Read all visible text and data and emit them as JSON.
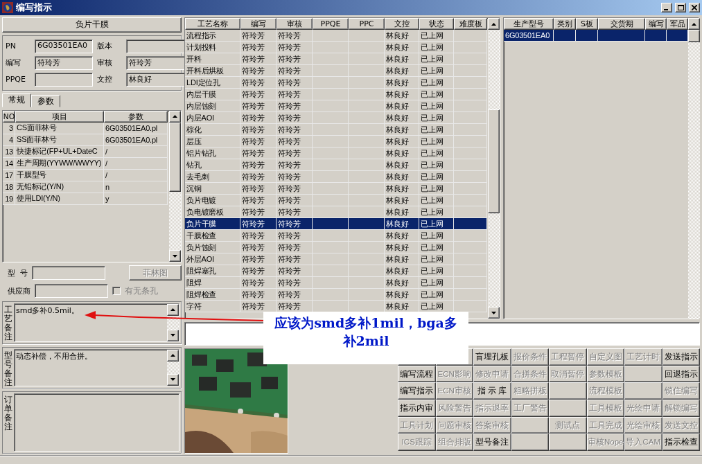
{
  "window": {
    "title": "编写指示"
  },
  "left": {
    "header_button": "负片干膜",
    "fields": [
      {
        "label": "PN",
        "value": "6G03501EA0"
      },
      {
        "label": "版本"
      },
      {
        "label": "编写",
        "value": "符玲芳"
      },
      {
        "label": "审核",
        "value": "符玲芳"
      },
      {
        "label": "PPQE"
      },
      {
        "label": "文控",
        "value": "林良好"
      }
    ],
    "tabs": [
      {
        "label": "常规",
        "selected": true
      },
      {
        "label": "参数",
        "selected": false
      }
    ],
    "grid": {
      "columns": [
        "NO",
        "项目",
        "参数"
      ],
      "rows": [
        {
          "no": "3",
          "item": "CS面菲林号",
          "param": "6G03501EA0.pl"
        },
        {
          "no": "4",
          "item": "SS面菲林号",
          "param": "6G03501EA0.pl"
        },
        {
          "no": "13",
          "item": "快捷标记(FP+UL+DateC",
          "param": "/"
        },
        {
          "no": "14",
          "item": "生产周期(YYWW/WWYY)",
          "param": "/"
        },
        {
          "no": "17",
          "item": "干膜型号",
          "param": "/"
        },
        {
          "no": "18",
          "item": "无铅标记(Y/N)",
          "param": "n"
        },
        {
          "no": "19",
          "item": "使用LDI(Y/N)",
          "param": "y"
        }
      ]
    },
    "model": {
      "label": "型  号",
      "button": "菲林图",
      "button_disabled": true
    },
    "supplier": {
      "label": "供应商",
      "checkbox": "有无条孔",
      "checked": false,
      "checkbox_disabled": true
    },
    "memos": [
      {
        "label": "工艺备注",
        "text": "smd多补0.5mil。",
        "scroll": true
      },
      {
        "label": "型号备注",
        "text": "动态补偿，不用合拼。",
        "scroll": true
      },
      {
        "label": "订单备注",
        "scroll": false
      }
    ]
  },
  "process_table": {
    "columns": [
      "工艺名称",
      "编写",
      "审核",
      "PPQE",
      "PPC",
      "文控",
      "状态",
      "难度板"
    ],
    "rows": [
      {
        "cells": [
          "流程指示",
          "符玲芳",
          "符玲芳",
          "",
          "",
          "林良好",
          "已上网",
          ""
        ],
        "selected": false
      },
      {
        "cells": [
          "计划投料",
          "符玲芳",
          "符玲芳",
          "",
          "",
          "林良好",
          "已上网",
          ""
        ],
        "selected": false
      },
      {
        "cells": [
          "开料",
          "符玲芳",
          "符玲芳",
          "",
          "",
          "林良好",
          "已上网",
          ""
        ],
        "selected": false
      },
      {
        "cells": [
          "开料后烘板",
          "符玲芳",
          "符玲芳",
          "",
          "",
          "林良好",
          "已上网",
          ""
        ],
        "selected": false
      },
      {
        "cells": [
          "LDI定位孔",
          "符玲芳",
          "符玲芳",
          "",
          "",
          "林良好",
          "已上网",
          ""
        ],
        "selected": false
      },
      {
        "cells": [
          "内层干膜",
          "符玲芳",
          "符玲芳",
          "",
          "",
          "林良好",
          "已上网",
          ""
        ],
        "selected": false
      },
      {
        "cells": [
          "内层蚀刻",
          "符玲芳",
          "符玲芳",
          "",
          "",
          "林良好",
          "已上网",
          ""
        ],
        "selected": false
      },
      {
        "cells": [
          "内层AOI",
          "符玲芳",
          "符玲芳",
          "",
          "",
          "林良好",
          "已上网",
          ""
        ],
        "selected": false
      },
      {
        "cells": [
          "棕化",
          "符玲芳",
          "符玲芳",
          "",
          "",
          "林良好",
          "已上网",
          ""
        ],
        "selected": false
      },
      {
        "cells": [
          "层压",
          "符玲芳",
          "符玲芳",
          "",
          "",
          "林良好",
          "已上网",
          ""
        ],
        "selected": false
      },
      {
        "cells": [
          "铝片钻孔",
          "符玲芳",
          "符玲芳",
          "",
          "",
          "林良好",
          "已上网",
          ""
        ],
        "selected": false
      },
      {
        "cells": [
          "钻孔",
          "符玲芳",
          "符玲芳",
          "",
          "",
          "林良好",
          "已上网",
          ""
        ],
        "selected": false
      },
      {
        "cells": [
          "去毛刺",
          "符玲芳",
          "符玲芳",
          "",
          "",
          "林良好",
          "已上网",
          ""
        ],
        "selected": false
      },
      {
        "cells": [
          "沉铜",
          "符玲芳",
          "符玲芳",
          "",
          "",
          "林良好",
          "已上网",
          ""
        ],
        "selected": false
      },
      {
        "cells": [
          "负片电镀",
          "符玲芳",
          "符玲芳",
          "",
          "",
          "林良好",
          "已上网",
          ""
        ],
        "selected": false
      },
      {
        "cells": [
          "负电镀磨板",
          "符玲芳",
          "符玲芳",
          "",
          "",
          "林良好",
          "已上网",
          ""
        ],
        "selected": false
      },
      {
        "cells": [
          "负片干膜",
          "符玲芳",
          "符玲芳",
          "",
          "",
          "林良好",
          "已上网",
          ""
        ],
        "selected": true
      },
      {
        "cells": [
          "干膜检查",
          "符玲芳",
          "符玲芳",
          "",
          "",
          "林良好",
          "已上网",
          ""
        ],
        "selected": false
      },
      {
        "cells": [
          "负片蚀刻",
          "符玲芳",
          "符玲芳",
          "",
          "",
          "林良好",
          "已上网",
          ""
        ],
        "selected": false
      },
      {
        "cells": [
          "外层AOI",
          "符玲芳",
          "符玲芳",
          "",
          "",
          "林良好",
          "已上网",
          ""
        ],
        "selected": false
      },
      {
        "cells": [
          "阻焊塞孔",
          "符玲芳",
          "符玲芳",
          "",
          "",
          "林良好",
          "已上网",
          ""
        ],
        "selected": false
      },
      {
        "cells": [
          "阻焊",
          "符玲芳",
          "符玲芳",
          "",
          "",
          "林良好",
          "已上网",
          ""
        ],
        "selected": false
      },
      {
        "cells": [
          "阻焊检查",
          "符玲芳",
          "符玲芳",
          "",
          "",
          "林良好",
          "已上网",
          ""
        ],
        "selected": false
      },
      {
        "cells": [
          "字符",
          "符玲芳",
          "符玲芳",
          "",
          "",
          "林良好",
          "已上网",
          ""
        ],
        "selected": false
      }
    ]
  },
  "model_table": {
    "columns": [
      "生产型号",
      "类别",
      "S板",
      "交货期",
      "编写",
      "军品"
    ],
    "rows": [
      {
        "cells": [
          "6G03501EA0",
          "",
          "",
          "",
          "",
          ""
        ],
        "selected": true
      }
    ]
  },
  "buttons": [
    [
      {
        "kind": "blank"
      },
      {
        "kind": "blank"
      },
      {
        "kind": "command",
        "label": "盲埋孔板",
        "disabled": false
      },
      {
        "kind": "command",
        "label": "报价条件",
        "disabled": true
      },
      {
        "kind": "command",
        "label": "工程暂停",
        "disabled": true
      },
      {
        "kind": "command",
        "label": "自定义图",
        "disabled": true
      },
      {
        "kind": "command",
        "label": "工艺计时",
        "disabled": true
      },
      {
        "kind": "command",
        "label": "发送指示",
        "disabled": false
      }
    ],
    [
      {
        "kind": "command",
        "label": "编写流程",
        "disabled": false
      },
      {
        "kind": "command",
        "label": "ECN影响",
        "disabled": true
      },
      {
        "kind": "command",
        "label": "修改申请",
        "disabled": true
      },
      {
        "kind": "command",
        "label": "合拼条件",
        "disabled": true
      },
      {
        "kind": "command",
        "label": "取消暂停",
        "disabled": true
      },
      {
        "kind": "command",
        "label": "参数模板",
        "disabled": true
      },
      {
        "kind": "blank"
      },
      {
        "kind": "command",
        "label": "回退指示",
        "disabled": false
      }
    ],
    [
      {
        "kind": "command",
        "label": "编写指示",
        "disabled": false
      },
      {
        "kind": "command",
        "label": "ECN审核",
        "disabled": true
      },
      {
        "kind": "command",
        "label": "指 示 库",
        "disabled": false
      },
      {
        "kind": "command",
        "label": "粗略拼板",
        "disabled": true
      },
      {
        "kind": "blank"
      },
      {
        "kind": "command",
        "label": "流程模板",
        "disabled": true
      },
      {
        "kind": "blank"
      },
      {
        "kind": "command",
        "label": "锁住编写",
        "disabled": true
      }
    ],
    [
      {
        "kind": "command",
        "label": "指示内审",
        "disabled": false
      },
      {
        "kind": "command",
        "label": "风险警告",
        "disabled": true
      },
      {
        "kind": "command",
        "label": "指示退率",
        "disabled": true
      },
      {
        "kind": "command",
        "label": "工厂警告",
        "disabled": true
      },
      {
        "kind": "blank"
      },
      {
        "kind": "command",
        "label": "工具模板",
        "disabled": true
      },
      {
        "kind": "command",
        "label": "光绘申请",
        "disabled": true
      },
      {
        "kind": "command",
        "label": "解锁编写",
        "disabled": true
      }
    ],
    [
      {
        "kind": "command",
        "label": "工具计划",
        "disabled": true
      },
      {
        "kind": "command",
        "label": "问题审核",
        "disabled": true
      },
      {
        "kind": "command",
        "label": "答案审核",
        "disabled": true
      },
      {
        "kind": "blank"
      },
      {
        "kind": "command",
        "label": "测试点",
        "disabled": true
      },
      {
        "kind": "command",
        "label": "工具完成",
        "disabled": true
      },
      {
        "kind": "command",
        "label": "光绘审核",
        "disabled": true
      },
      {
        "kind": "command",
        "label": "发送文控",
        "disabled": true
      }
    ],
    [
      {
        "kind": "command",
        "label": "ICS跟踪",
        "disabled": true
      },
      {
        "kind": "command",
        "label": "组合排版",
        "disabled": true
      },
      {
        "kind": "command",
        "label": "型号备注",
        "disabled": false
      },
      {
        "kind": "blank"
      },
      {
        "kind": "blank"
      },
      {
        "kind": "command",
        "label": "审核Nope",
        "disabled": true
      },
      {
        "kind": "command",
        "label": "导入CAM",
        "disabled": true
      },
      {
        "kind": "command",
        "label": "指示检查",
        "disabled": false
      }
    ]
  ],
  "annotation": {
    "text": "应该为smd多补1mil，bga多补2mil"
  }
}
